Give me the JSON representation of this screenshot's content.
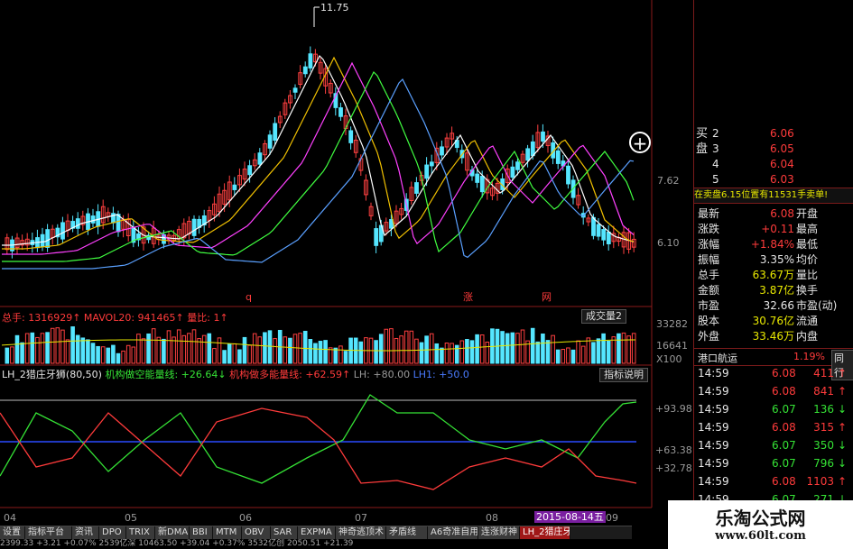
{
  "price_chart": {
    "high_marker": "11.75",
    "right_labels": [
      "7.62",
      "6.10"
    ],
    "date_marks": [
      "q",
      "涨",
      "网"
    ]
  },
  "volume_panel": {
    "stats_label": "总手: 1316929↑ MAVOL20: 941465↑ 量比: 1↑",
    "button": "成交量2",
    "y_labels": [
      "33282",
      "16641",
      "X100"
    ]
  },
  "indicator_panel": {
    "title": "LH_2猎庄牙狮(80,50)",
    "line1_label": "机构做空能量线: +26.64",
    "line2_label": "机构做多能量线: +62.59",
    "lh_label": "LH: +80.00",
    "lh1_label": "LH1: +50.0",
    "button": "指标说明",
    "y_labels": [
      "+93.98",
      "+63.38",
      "+32.78"
    ]
  },
  "x_axis": {
    "labels": [
      "04",
      "05",
      "06",
      "07",
      "08",
      "09"
    ],
    "highlight_date": "2015-08-14五"
  },
  "right_panel": {
    "buy_side_label": "买盘",
    "order_book": [
      {
        "level": "2",
        "price": "6.06"
      },
      {
        "level": "3",
        "price": "6.05"
      },
      {
        "level": "4",
        "price": "6.04"
      },
      {
        "level": "5",
        "price": "6.03"
      }
    ],
    "notice": "在卖盘6.15位置有11531手卖单!",
    "quote_rows": [
      {
        "l1": "最新",
        "v1": "6.08",
        "l2": "开盘"
      },
      {
        "l1": "涨跌",
        "v1": "+0.11",
        "l2": "最高"
      },
      {
        "l1": "涨幅",
        "v1": "+1.84%",
        "l2": "最低"
      },
      {
        "l1": "振幅",
        "v1": "3.35%",
        "l2": "均价"
      },
      {
        "l1": "总手",
        "v1": "63.67万",
        "l2": "量比"
      },
      {
        "l1": "金额",
        "v1": "3.87亿",
        "l2": "换手"
      },
      {
        "l1": "市盈",
        "v1": "32.66",
        "l2": "市盈(动)"
      },
      {
        "l1": "股本",
        "v1": "30.76亿",
        "l2": "流通"
      },
      {
        "l1": "外盘",
        "v1": "33.46万",
        "l2": "内盘"
      }
    ],
    "sector": "港口航运",
    "sector_change": "1.19%",
    "sector_button": "同行",
    "ticks": [
      {
        "time": "14:59",
        "price": "6.08",
        "vol": "411",
        "dir": "up"
      },
      {
        "time": "14:59",
        "price": "6.08",
        "vol": "841",
        "dir": "up"
      },
      {
        "time": "14:59",
        "price": "6.07",
        "vol": "136",
        "dir": "down"
      },
      {
        "time": "14:59",
        "price": "6.08",
        "vol": "315",
        "dir": "up"
      },
      {
        "time": "14:59",
        "price": "6.07",
        "vol": "350",
        "dir": "down"
      },
      {
        "time": "14:59",
        "price": "6.07",
        "vol": "796",
        "dir": "down"
      },
      {
        "time": "14:59",
        "price": "6.08",
        "vol": "1103",
        "dir": "up"
      },
      {
        "time": "14:59",
        "price": "6.07",
        "vol": "271",
        "dir": "down"
      }
    ]
  },
  "tabs": [
    "设置",
    "指标平台",
    "资讯",
    "DPO",
    "TRIX",
    "新DMA",
    "BBI",
    "MTM",
    "OBV",
    "SAR",
    "EXPMA",
    "神奇逃顶术",
    "矛盾线",
    "A6奇准自用",
    "连涨财神",
    "LH_2猎庄牙狮"
  ],
  "status_bar": "2399.33  +3.21  +0.07%  2539亿深  10463.50  +39.04  +0.37%  3532亿创  2050.51  +21.39",
  "watermark": {
    "title": "乐淘公式网",
    "url": "www.60lt.com"
  },
  "colors": {
    "up": "#ff3b3b",
    "down": "#00e5ff",
    "background": "#000000"
  }
}
